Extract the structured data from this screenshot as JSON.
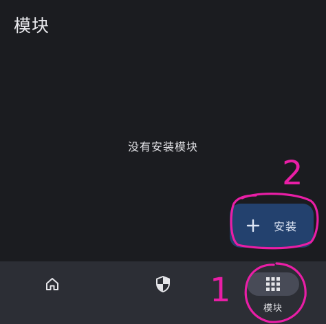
{
  "header": {
    "title": "模块"
  },
  "main": {
    "empty_message": "没有安装模块"
  },
  "fab": {
    "label": "安装",
    "icon": "plus-icon",
    "color": "#23416e"
  },
  "bottom_nav": {
    "items": [
      {
        "icon": "home-icon",
        "label": "",
        "selected": false
      },
      {
        "icon": "shield-icon",
        "label": "",
        "selected": false
      },
      {
        "icon": "grid-icon",
        "label": "模块",
        "selected": true
      }
    ]
  },
  "annotations": {
    "color": "#e91ea6",
    "labels": [
      "1",
      "2"
    ]
  }
}
